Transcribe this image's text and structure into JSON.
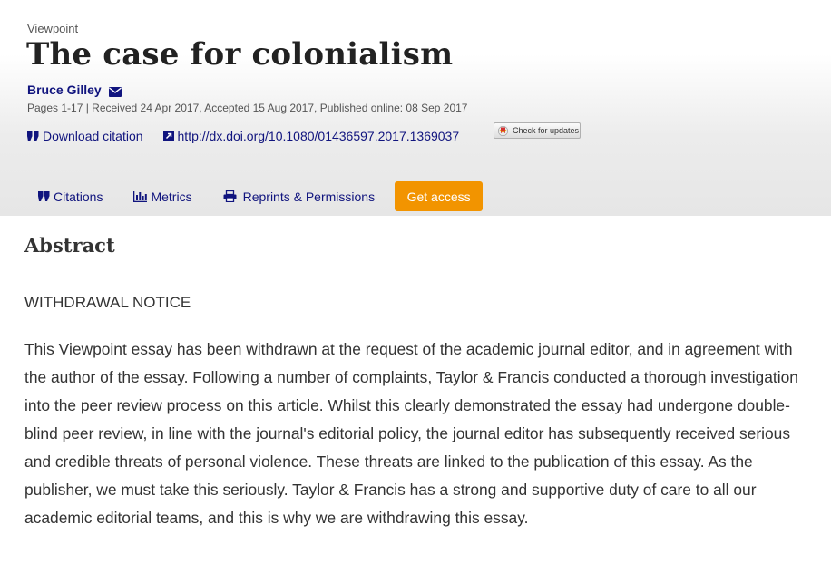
{
  "article": {
    "type_label": "Viewpoint",
    "title": "The case for colonialism",
    "author": "Bruce Gilley",
    "meta": "Pages 1-17 | Received 24 Apr 2017, Accepted 15 Aug 2017, Published online: 08 Sep 2017"
  },
  "links": {
    "download_citation": "Download citation",
    "doi": "http://dx.doi.org/10.1080/01436597.2017.1369037",
    "check_updates": "Check for updates"
  },
  "tabs": {
    "citations": "Citations",
    "metrics": "Metrics",
    "reprints": "Reprints & Permissions",
    "get_access": "Get access"
  },
  "abstract": {
    "heading": "Abstract",
    "notice": "WITHDRAWAL NOTICE",
    "body": "This Viewpoint essay has been withdrawn at the request of the academic journal editor, and in agreement with the author of the essay. Following a number of complaints, Taylor & Francis conducted a thorough investigation into the peer review process on this article. Whilst this clearly demonstrated the essay had undergone double-blind peer review, in line with the journal's editorial policy, the journal editor has subsequently received serious and credible threats of personal violence. These threats are linked to the publication of this essay. As the publisher, we must take this seriously. Taylor & Francis has a strong and supportive duty of care to all our academic editorial teams, and this is why we are withdrawing this essay."
  },
  "icons": {
    "author_contact": "envelope-icon",
    "download_citation": "quote-icon",
    "doi": "external-link-icon",
    "check_updates": "crossmark-icon",
    "citations": "quote-icon",
    "metrics": "bar-chart-icon",
    "reprints": "printer-icon"
  },
  "colors": {
    "link": "#10147e",
    "accent": "#f29400",
    "text": "#333333"
  }
}
